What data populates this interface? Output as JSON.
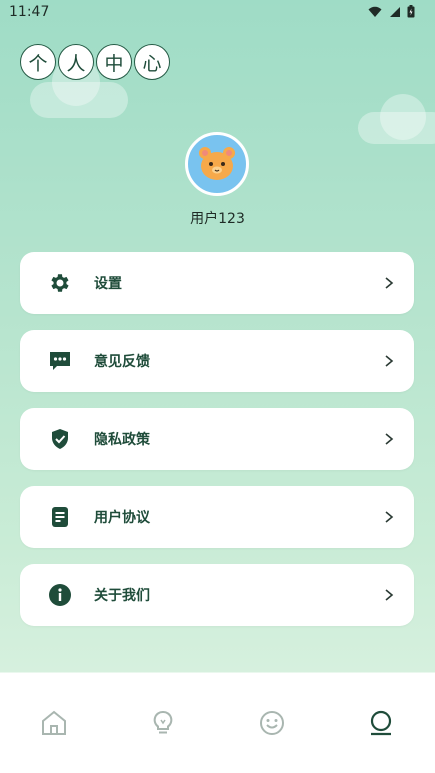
{
  "status_bar": {
    "time": "11:47"
  },
  "header": {
    "title_chars": [
      "个",
      "人",
      "中",
      "心"
    ]
  },
  "profile": {
    "username": "用户123"
  },
  "menu": {
    "items": [
      {
        "label": "设置",
        "icon": "gear-icon"
      },
      {
        "label": "意见反馈",
        "icon": "chat-bubble-icon"
      },
      {
        "label": "隐私政策",
        "icon": "shield-check-icon"
      },
      {
        "label": "用户协议",
        "icon": "document-icon"
      },
      {
        "label": "关于我们",
        "icon": "info-icon"
      }
    ]
  },
  "bottom_nav": {
    "items": [
      {
        "icon": "home-icon",
        "active": false
      },
      {
        "icon": "lightbulb-icon",
        "active": false
      },
      {
        "icon": "smiley-icon",
        "active": false
      },
      {
        "icon": "profile-icon",
        "active": true
      }
    ]
  },
  "colors": {
    "accent": "#1f4c3a",
    "inactive_icon": "#a9b6b0",
    "background_top": "#9fdcc6"
  }
}
